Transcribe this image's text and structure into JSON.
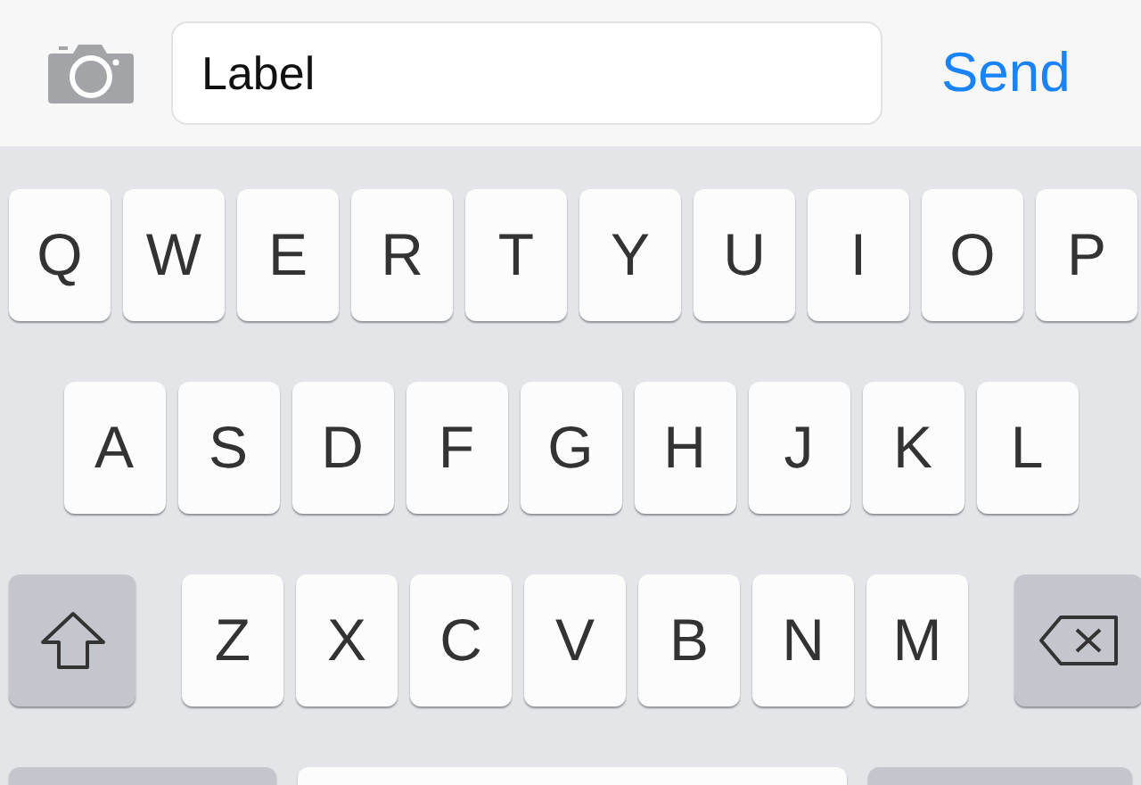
{
  "composer": {
    "field": {
      "value": "Label"
    },
    "send_button": "Send"
  },
  "keyboard": {
    "rows": [
      [
        {
          "kind": "letter",
          "label": "Q"
        },
        {
          "kind": "letter",
          "label": "W"
        },
        {
          "kind": "letter",
          "label": "E"
        },
        {
          "kind": "letter",
          "label": "R"
        },
        {
          "kind": "letter",
          "label": "T"
        },
        {
          "kind": "letter",
          "label": "Y"
        },
        {
          "kind": "letter",
          "label": "U"
        },
        {
          "kind": "letter",
          "label": "I"
        },
        {
          "kind": "letter",
          "label": "O"
        },
        {
          "kind": "letter",
          "label": "P"
        }
      ],
      [
        {
          "kind": "letter",
          "label": "A"
        },
        {
          "kind": "letter",
          "label": "S"
        },
        {
          "kind": "letter",
          "label": "D"
        },
        {
          "kind": "letter",
          "label": "F"
        },
        {
          "kind": "letter",
          "label": "G"
        },
        {
          "kind": "letter",
          "label": "H"
        },
        {
          "kind": "letter",
          "label": "J"
        },
        {
          "kind": "letter",
          "label": "K"
        },
        {
          "kind": "letter",
          "label": "L"
        }
      ],
      [
        {
          "kind": "shift"
        },
        {
          "kind": "letter",
          "label": "Z"
        },
        {
          "kind": "letter",
          "label": "X"
        },
        {
          "kind": "letter",
          "label": "C"
        },
        {
          "kind": "letter",
          "label": "V"
        },
        {
          "kind": "letter",
          "label": "B"
        },
        {
          "kind": "letter",
          "label": "N"
        },
        {
          "kind": "letter",
          "label": "M"
        },
        {
          "kind": "delete"
        }
      ],
      [
        {
          "kind": "function"
        },
        {
          "kind": "space"
        },
        {
          "kind": "function"
        }
      ]
    ]
  }
}
